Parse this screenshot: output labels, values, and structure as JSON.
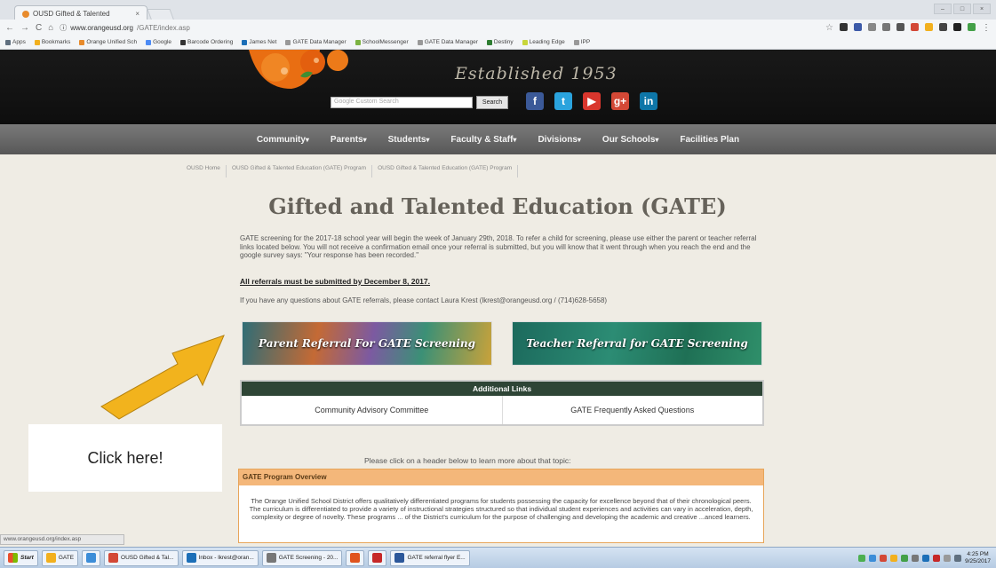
{
  "browser": {
    "tab_title": "OUSD Gifted & Talented",
    "tab_close": "×",
    "nav_back": "←",
    "nav_forward": "→",
    "nav_reload": "C",
    "nav_home": "⌂",
    "url_domain": "www.orangeusd.org",
    "url_path": "/GATE/index.asp",
    "bookmarks": [
      {
        "label": "Apps",
        "color": "#5f6f7f"
      },
      {
        "label": "Bookmarks",
        "color": "#f2b01e"
      },
      {
        "label": "Orange Unified Sch",
        "color": "#e88b2c"
      },
      {
        "label": "Google",
        "color": "#4c8bf5"
      },
      {
        "label": "Barcode Ordering",
        "color": "#333333"
      },
      {
        "label": "James Net",
        "color": "#1c6fb8"
      },
      {
        "label": "GATE Data Manager",
        "color": "#999999"
      },
      {
        "label": "SchoolMessenger",
        "color": "#7cb342"
      },
      {
        "label": "GATE Data Manager",
        "color": "#999999"
      },
      {
        "label": "Destiny",
        "color": "#2e7d32"
      },
      {
        "label": "Leading Edge",
        "color": "#c8d63a"
      },
      {
        "label": "IPP",
        "color": "#999999"
      }
    ]
  },
  "header": {
    "established": "Established 1953",
    "search_placeholder": "Google Custom Search",
    "search_button": "Search",
    "socials": [
      {
        "icon": "facebook-icon",
        "glyph": "f",
        "color": "#3b5998"
      },
      {
        "icon": "twitter-icon",
        "glyph": "t",
        "color": "#2aa3dd"
      },
      {
        "icon": "youtube-icon",
        "glyph": "▶",
        "color": "#d9362d"
      },
      {
        "icon": "google-plus-icon",
        "glyph": "g+",
        "color": "#d34836"
      },
      {
        "icon": "linkedin-icon",
        "glyph": "in",
        "color": "#0e76a8"
      }
    ]
  },
  "nav": [
    "Community",
    "Parents",
    "Students",
    "Faculty & Staff",
    "Divisions",
    "Our Schools",
    "Facilities Plan"
  ],
  "nav_dropdown_marker": "▾",
  "breadcrumb": [
    "OUSD Home",
    "OUSD Gifted & Talented Education (GATE) Program",
    "OUSD Gifted & Talented Education (GATE) Program"
  ],
  "page": {
    "title": "Gifted and Talented Education (GATE)",
    "intro": "GATE screening for the 2017-18 school year will begin the week of January 29th, 2018.  To refer a child for screening, please use either the parent or teacher referral links located below.  You will not receive a confirmation email once your referral is submitted, but you will know that it went through when you reach the end and the google survey says: \"Your response has been recorded.\"",
    "deadline": "All referrals must be submitted by December 8, 2017.",
    "contact": "If you have any questions about GATE referrals, please contact Laura Krest (lkrest@orangeusd.org / (714)628-5658)",
    "parent_button": "Parent Referral For GATE Screening",
    "teacher_button": "Teacher Referral for GATE Screening",
    "additional_links_header": "Additional Links",
    "additional_links": [
      "Community Advisory Committee",
      "GATE Frequently Asked Questions"
    ],
    "please_click": "Please click on a header below to learn more about that topic:",
    "overview_header": "GATE Program Overview",
    "overview_body": "The Orange Unified School District offers qualitatively differentiated programs for students possessing the capacity for excellence beyond that of their chronological peers. The curriculum is differentiated to provide a variety of instructional strategies structured so that individual student experiences and activities can vary in acceleration, depth, complexity or degree of novelty. These programs ... of the District's curriculum for the purpose of challenging and developing the academic and creative ...anced learners."
  },
  "annotation": {
    "callout": "Click here!",
    "arrow_color": "#f2b31d"
  },
  "status_url": "www.orangeusd.org/index.asp",
  "taskbar": {
    "start": "Start",
    "items": [
      {
        "label": "GATE",
        "color": "#f2b01e"
      },
      {
        "label": "",
        "color": "#3c8dd8"
      },
      {
        "label": "OUSD Gifted & Tal...",
        "color": "#d34836"
      },
      {
        "label": "Inbox - lkrest@oran...",
        "color": "#1c6fb8"
      },
      {
        "label": "GATE Screening - 20...",
        "color": "#777777"
      },
      {
        "label": "",
        "color": "#e0541f"
      },
      {
        "label": "",
        "color": "#c62828"
      },
      {
        "label": "GATE referral flyer E...",
        "color": "#2b579a"
      }
    ],
    "time": "4:25 PM",
    "date": "9/25/2017"
  }
}
